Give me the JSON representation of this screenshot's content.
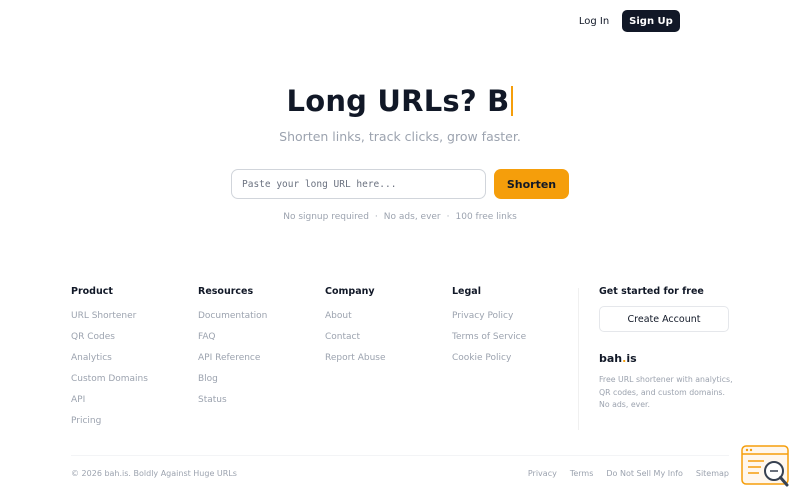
{
  "header": {
    "login_label": "Log In",
    "signup_label": "Sign Up"
  },
  "hero": {
    "title": "Long URLs? B",
    "subtitle": "Shorten links, track clicks, grow faster.",
    "input_placeholder": "Paste your long URL here...",
    "shorten_label": "Shorten",
    "features": [
      "No signup required",
      "No ads, ever",
      "100 free links"
    ],
    "feature_separator": "·"
  },
  "footer": {
    "columns": [
      {
        "title": "Product",
        "links": [
          "URL Shortener",
          "QR Codes",
          "Analytics",
          "Custom Domains",
          "API",
          "Pricing"
        ]
      },
      {
        "title": "Resources",
        "links": [
          "Documentation",
          "FAQ",
          "API Reference",
          "Blog",
          "Status"
        ]
      },
      {
        "title": "Company",
        "links": [
          "About",
          "Contact",
          "Report Abuse"
        ]
      },
      {
        "title": "Legal",
        "links": [
          "Privacy Policy",
          "Terms of Service",
          "Cookie Policy"
        ]
      }
    ],
    "cta": {
      "title": "Get started for free",
      "button_label": "Create Account",
      "brand_name": "bah",
      "brand_dot": ".",
      "brand_tld": "is",
      "description": "Free URL shortener with analytics, QR codes, and custom domains. No ads, ever."
    },
    "copyright": "© 2026 bah.is. Boldly Against Huge URLs",
    "bottom_links": [
      "Privacy",
      "Terms",
      "Do Not Sell My Info",
      "Sitemap"
    ]
  },
  "widget": {
    "icon": "search-help-icon"
  },
  "colors": {
    "accent": "#f59e0b",
    "dark": "#111827",
    "muted": "#9ca3af"
  }
}
